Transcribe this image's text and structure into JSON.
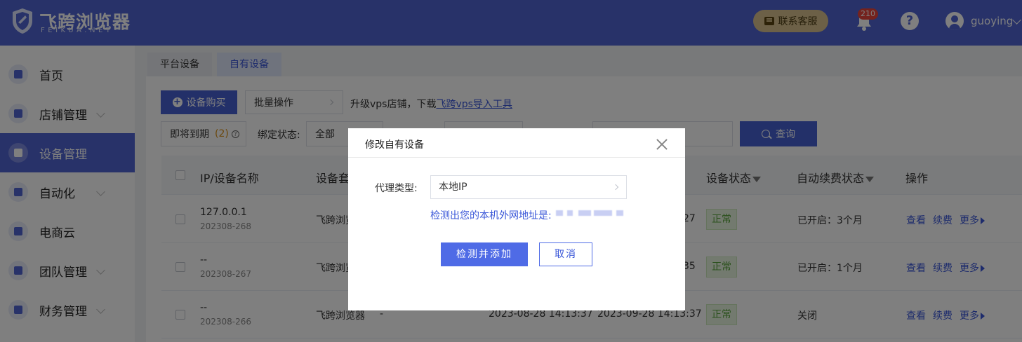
{
  "header": {
    "logo_title": "飞跨浏览器",
    "logo_sub": "FEIKUA.NET",
    "service_label": "联系客服",
    "notification_count": "210",
    "help_glyph": "?",
    "username": "guoying"
  },
  "sidebar": {
    "items": [
      {
        "label": "首页",
        "icon": "home-icon"
      },
      {
        "label": "店铺管理",
        "icon": "store-icon"
      },
      {
        "label": "设备管理",
        "icon": "device-icon",
        "active": true
      },
      {
        "label": "自动化",
        "icon": "robot-icon"
      },
      {
        "label": "电商云",
        "icon": "cloud-icon"
      },
      {
        "label": "团队管理",
        "icon": "team-icon"
      },
      {
        "label": "财务管理",
        "icon": "wallet-icon"
      }
    ]
  },
  "tabs": [
    "平台设备",
    "自有设备"
  ],
  "toolbar": {
    "buy_label": "设备购买",
    "batch_label": "批量操作",
    "promo_text": "升级vps店铺，下载",
    "promo_link": "飞跨vps导入工具",
    "expiring_label": "即将到期",
    "expiring_count": "(2)",
    "bind_label": "绑定状态:",
    "bind_value": "全部",
    "query_label": "查询"
  },
  "table": {
    "columns": [
      "IP/设备名称",
      "设备套",
      "设备状态",
      "自动续费状态",
      "操作"
    ],
    "rows": [
      {
        "ip": "127.0.0.1",
        "id": "202308-268",
        "pkg": "飞跨浏览",
        "pkg_extra": "",
        "created": "",
        "expire_tail": "27",
        "status": "正常",
        "renew": "已开启：3个月"
      },
      {
        "ip": "--",
        "id": "202308-267",
        "pkg": "飞跨浏览",
        "pkg_extra": "",
        "created": "",
        "expire_tail": "35",
        "status": "正常",
        "renew": "已开启：1个月"
      },
      {
        "ip": "--",
        "id": "202308-266",
        "pkg": "飞跨浏览器",
        "pkg_extra": "-",
        "created": "2023-08-28 14:13:37",
        "expire_tail": "2023-09-28 14:13:37",
        "status": "正常",
        "renew": "关闭"
      }
    ],
    "ops": [
      "查看",
      "续费",
      "更多"
    ]
  },
  "modal": {
    "title": "修改自有设备",
    "proxy_label": "代理类型:",
    "proxy_value": "本地IP",
    "hint": "检测出您的本机外网地址是:",
    "ok_label": "检测并添加",
    "cancel_label": "取消"
  },
  "colors": {
    "brand": "#5064d2",
    "link": "#3a57d8",
    "status_ok": "#57a23a"
  }
}
